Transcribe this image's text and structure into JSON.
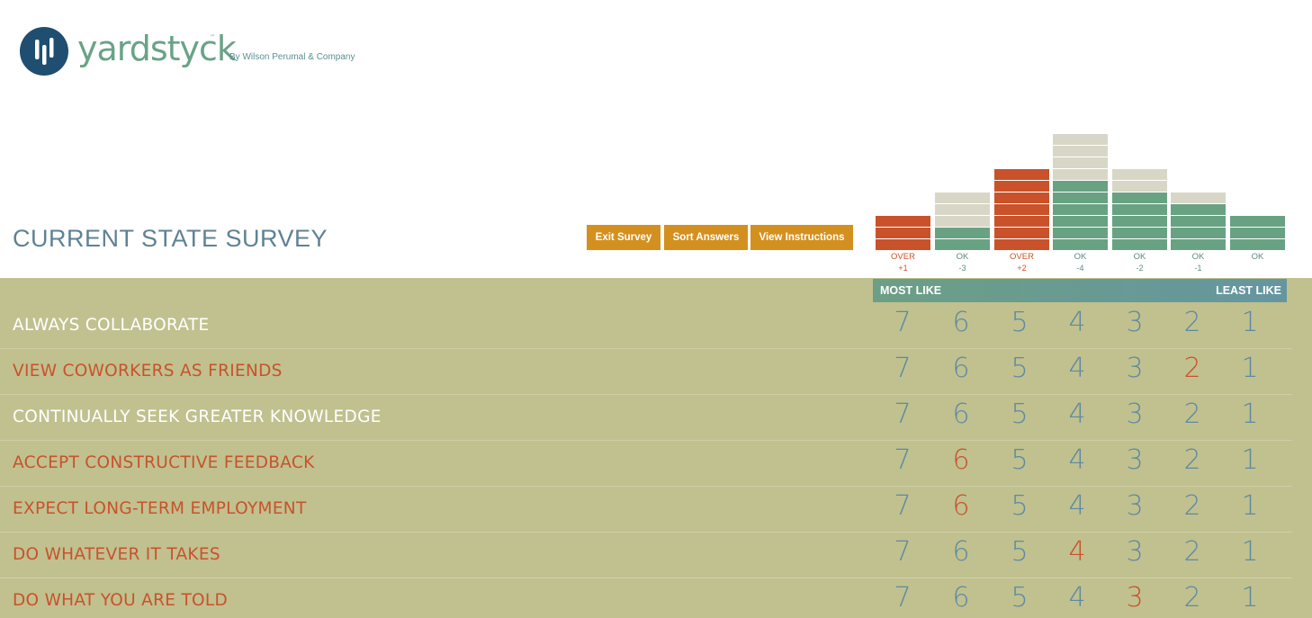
{
  "brand": {
    "name": "yardstyck",
    "tm": "™",
    "by": "By Wilson Perumal & Company",
    "colors": {
      "navy": "#1f4e70",
      "green": "#6aa386"
    }
  },
  "page_title": "CURRENT STATE SURVEY",
  "toolbar": {
    "exit_label": "Exit Survey",
    "sort_label": "Sort Answers",
    "instructions_label": "View Instructions"
  },
  "distribution": {
    "columns": [
      {
        "score": 7,
        "filled": 3,
        "slots": 3,
        "status": "OVER",
        "diff": "+1"
      },
      {
        "score": 6,
        "filled": 2,
        "slots": 5,
        "status": "OK",
        "diff": "-3"
      },
      {
        "score": 5,
        "filled": 7,
        "slots": 7,
        "status": "OVER",
        "diff": "+2"
      },
      {
        "score": 4,
        "filled": 6,
        "slots": 10,
        "status": "OK",
        "diff": "-4"
      },
      {
        "score": 3,
        "filled": 5,
        "slots": 7,
        "status": "OK",
        "diff": "-2"
      },
      {
        "score": 2,
        "filled": 4,
        "slots": 5,
        "status": "OK",
        "diff": "-1"
      },
      {
        "score": 1,
        "filled": 3,
        "slots": 3,
        "status": "OK",
        "diff": ""
      }
    ]
  },
  "scale": {
    "most": "MOST LIKE",
    "least": "LEAST LIKE",
    "values": [
      "7",
      "6",
      "5",
      "4",
      "3",
      "2",
      "1"
    ]
  },
  "statements": [
    {
      "label": "ALWAYS COLLABORATE",
      "answered": false,
      "selected": null
    },
    {
      "label": "VIEW COWORKERS AS FRIENDS",
      "answered": true,
      "selected": "2"
    },
    {
      "label": "CONTINUALLY SEEK GREATER KNOWLEDGE",
      "answered": false,
      "selected": null
    },
    {
      "label": "ACCEPT CONSTRUCTIVE FEEDBACK",
      "answered": true,
      "selected": "6"
    },
    {
      "label": "EXPECT LONG-TERM EMPLOYMENT",
      "answered": true,
      "selected": "6"
    },
    {
      "label": "DO WHATEVER IT TAKES",
      "answered": true,
      "selected": "4"
    },
    {
      "label": "DO WHAT YOU ARE TOLD",
      "answered": true,
      "selected": "3"
    }
  ]
}
